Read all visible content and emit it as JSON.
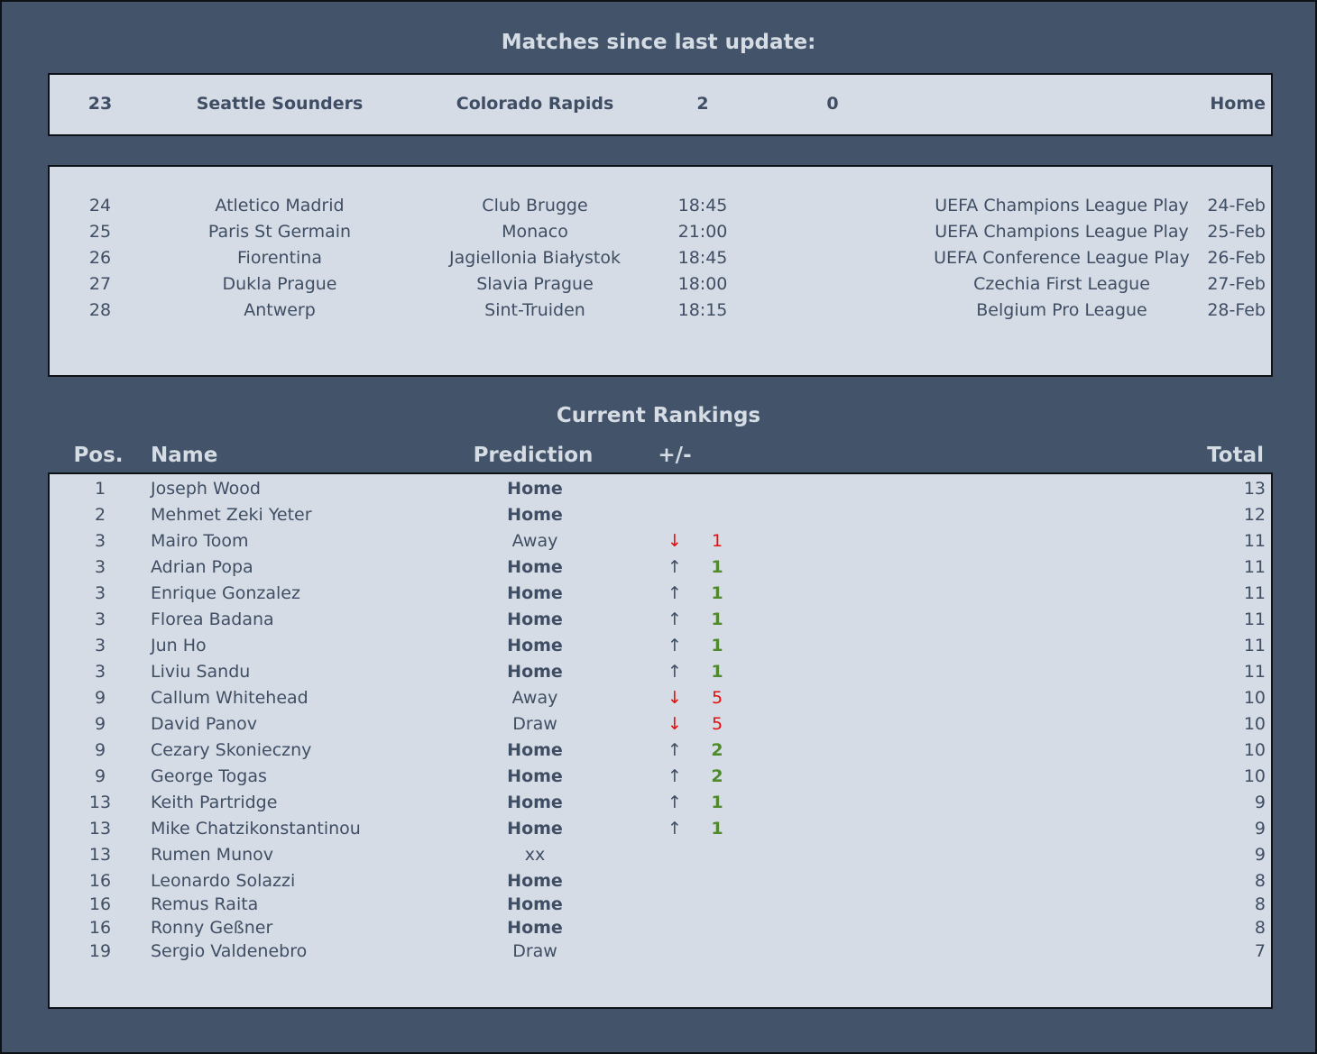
{
  "recent": {
    "title": "Matches since last update:",
    "match": {
      "no": "23",
      "home": "Seattle Sounders",
      "away": "Colorado Rapids",
      "home_goals": "2",
      "away_goals": "0",
      "result": "Home"
    }
  },
  "upcoming": [
    {
      "no": "24",
      "home": "Atletico Madrid",
      "away": "Club Brugge",
      "time": "18:45",
      "competition": "UEFA Champions League Play",
      "date": "24-Feb"
    },
    {
      "no": "25",
      "home": "Paris St Germain",
      "away": "Monaco",
      "time": "21:00",
      "competition": "UEFA Champions League Play",
      "date": "25-Feb"
    },
    {
      "no": "26",
      "home": "Fiorentina",
      "away": "Jagiellonia Białystok",
      "time": "18:45",
      "competition": "UEFA Conference League Play",
      "date": "26-Feb"
    },
    {
      "no": "27",
      "home": "Dukla Prague",
      "away": "Slavia Prague",
      "time": "18:00",
      "competition": "Czechia First League",
      "date": "27-Feb"
    },
    {
      "no": "28",
      "home": "Antwerp",
      "away": "Sint-Truiden",
      "time": "18:15",
      "competition": "Belgium Pro League",
      "date": "28-Feb"
    }
  ],
  "rankings": {
    "title": "Current Rankings",
    "headers": {
      "pos": "Pos.",
      "name": "Name",
      "prediction": "Prediction",
      "change": "+/-",
      "total": "Total"
    },
    "rows": [
      {
        "pos": "1",
        "name": "Joseph Wood",
        "prediction": "Home",
        "arrow": "",
        "change": "",
        "total": "13"
      },
      {
        "pos": "2",
        "name": "Mehmet Zeki Yeter",
        "prediction": "Home",
        "arrow": "",
        "change": "",
        "total": "12"
      },
      {
        "pos": "3",
        "name": "Mairo Toom",
        "prediction": "Away",
        "arrow": "↓",
        "change": "1",
        "total": "11"
      },
      {
        "pos": "3",
        "name": "Adrian Popa",
        "prediction": "Home",
        "arrow": "↑",
        "change": "1",
        "total": "11"
      },
      {
        "pos": "3",
        "name": "Enrique Gonzalez",
        "prediction": "Home",
        "arrow": "↑",
        "change": "1",
        "total": "11"
      },
      {
        "pos": "3",
        "name": "Florea Badana",
        "prediction": "Home",
        "arrow": "↑",
        "change": "1",
        "total": "11"
      },
      {
        "pos": "3",
        "name": "Jun Ho",
        "prediction": "Home",
        "arrow": "↑",
        "change": "1",
        "total": "11"
      },
      {
        "pos": "3",
        "name": "Liviu Sandu",
        "prediction": "Home",
        "arrow": "↑",
        "change": "1",
        "total": "11"
      },
      {
        "pos": "9",
        "name": "Callum Whitehead",
        "prediction": "Away",
        "arrow": "↓",
        "change": "5",
        "total": "10"
      },
      {
        "pos": "9",
        "name": "David Panov",
        "prediction": "Draw",
        "arrow": "↓",
        "change": "5",
        "total": "10"
      },
      {
        "pos": "9",
        "name": "Cezary Skonieczny",
        "prediction": "Home",
        "arrow": "↑",
        "change": "2",
        "total": "10"
      },
      {
        "pos": "9",
        "name": "George Togas",
        "prediction": "Home",
        "arrow": "↑",
        "change": "2",
        "total": "10"
      },
      {
        "pos": "13",
        "name": "Keith Partridge",
        "prediction": "Home",
        "arrow": "↑",
        "change": "1",
        "total": "9"
      },
      {
        "pos": "13",
        "name": "Mike Chatzikonstantinou",
        "prediction": "Home",
        "arrow": "↑",
        "change": "1",
        "total": "9"
      },
      {
        "pos": "13",
        "name": "Rumen Munov",
        "prediction": "xx",
        "arrow": "",
        "change": "",
        "total": "9"
      },
      {
        "pos": "16",
        "name": "Leonardo Solazzi",
        "prediction": "Home",
        "arrow": "",
        "change": "",
        "total": "8"
      },
      {
        "pos": "16",
        "name": "Remus Raita",
        "prediction": "Home",
        "arrow": "",
        "change": "",
        "total": "8"
      },
      {
        "pos": "16",
        "name": "Ronny Geßner",
        "prediction": "Home",
        "arrow": "",
        "change": "",
        "total": "8"
      },
      {
        "pos": "19",
        "name": "Sergio Valdenebro",
        "prediction": "Draw",
        "arrow": "",
        "change": "",
        "total": "7"
      }
    ]
  },
  "colors": {
    "background": "#42536a",
    "panel": "#d5dce5",
    "text": "#3f4e64",
    "gain": "#4f8a2d",
    "loss": "#e50e0e"
  }
}
